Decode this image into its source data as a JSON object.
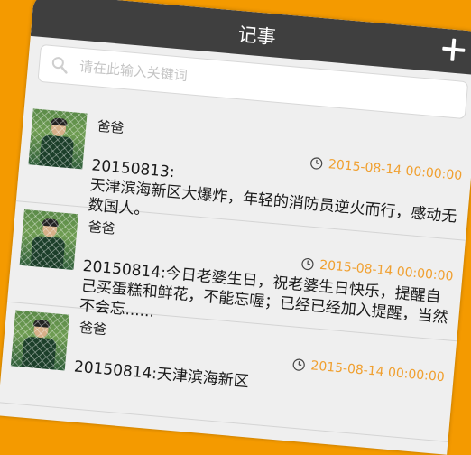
{
  "header": {
    "title": "记事",
    "add_icon": "plus-icon"
  },
  "search": {
    "placeholder": "请在此输入关键词",
    "icon": "search-icon"
  },
  "notes": [
    {
      "author": "爸爸",
      "time": "2015-08-14 00:00:00",
      "content": "20150813:\n天津滨海新区大爆炸，年轻的消防员逆火而行，感动无数国人。"
    },
    {
      "author": "爸爸",
      "time": "2015-08-14 00:00:00",
      "content": "20150814:今日老婆生日，祝老婆生日快乐，提醒自己买蛋糕和鲜花，不能忘喔；已经已经加入提醒，当然不会忘......"
    },
    {
      "author": "爸爸",
      "time": "2015-08-14 00:00:00",
      "content": "20150814:天津滨海新区"
    }
  ],
  "colors": {
    "background": "#f49a00",
    "titlebar": "#3f3f3f",
    "time": "#f0a030"
  }
}
